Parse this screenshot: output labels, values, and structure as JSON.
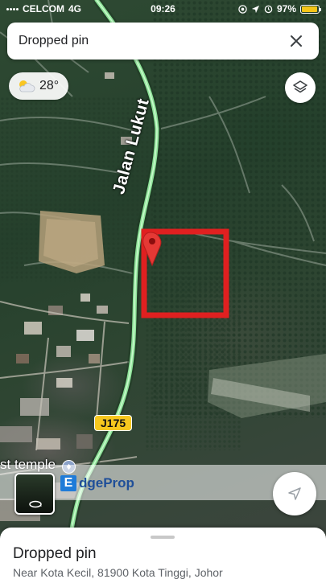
{
  "status_bar": {
    "carrier": "CELCOM",
    "network": "4G",
    "time": "09:26",
    "battery_percent": "97%",
    "battery_level": 0.97
  },
  "search_card": {
    "title": "Dropped pin",
    "close_icon": "close-icon"
  },
  "weather": {
    "temperature": "28°",
    "icon": "partly-cloudy-icon"
  },
  "map": {
    "road_name": "Jalan Lukut",
    "route_number": "J175",
    "place_label": "st temple",
    "pin_color": "#e53935",
    "highlight_color": "#e02020",
    "road_color": "#8fe39a"
  },
  "watermark": {
    "logo_letter": "E",
    "logo_text": "dgeProp"
  },
  "bottom_sheet": {
    "title": "Dropped pin",
    "address": "Near Kota Kecil, 81900 Kota Tinggi, Johor"
  }
}
